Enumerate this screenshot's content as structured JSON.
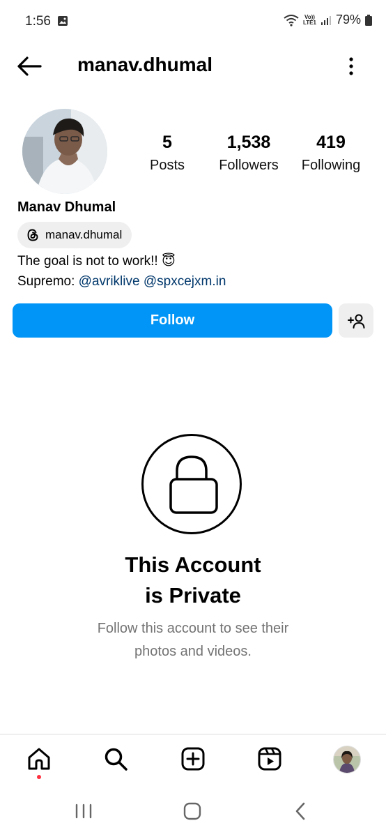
{
  "status_bar": {
    "time": "1:56",
    "network_top": "Vo))",
    "network_bottom": "LTE1",
    "battery": "79%"
  },
  "header": {
    "username": "manav.dhumal"
  },
  "profile": {
    "stats": [
      {
        "value": "5",
        "label": "Posts"
      },
      {
        "value": "1,538",
        "label": "Followers"
      },
      {
        "value": "419",
        "label": "Following"
      }
    ],
    "display_name": "Manav Dhumal",
    "threads_handle": "manav.dhumal",
    "bio_line1": "The goal is not to work!! 😇",
    "bio_prefix": "Supremo:",
    "mentions": [
      "@avriklive",
      "@spxcejxm.in"
    ]
  },
  "actions": {
    "follow_label": "Follow"
  },
  "private": {
    "title_line1": "This Account",
    "title_line2": "is Private",
    "subtitle_line1": "Follow this account to see their",
    "subtitle_line2": "photos and videos."
  },
  "colors": {
    "accent": "#0095f6",
    "mention": "#00376b",
    "secondary_text": "#737373",
    "notification_dot": "#ff3040"
  },
  "icons": {
    "nav": [
      "home-icon",
      "search-icon",
      "create-icon",
      "reels-icon",
      "profile-avatar"
    ]
  }
}
